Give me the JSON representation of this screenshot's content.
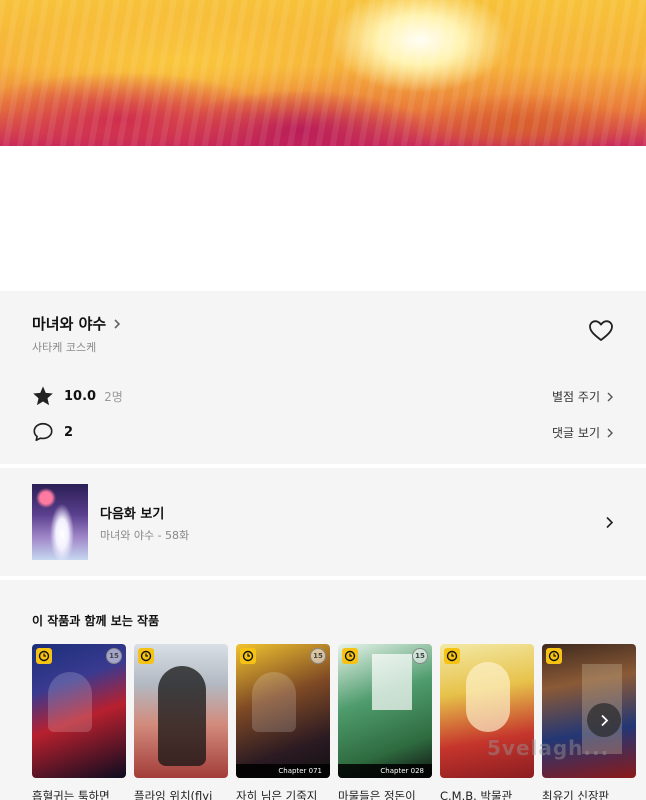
{
  "header": {
    "hero_image": "sunset-clouds-banner"
  },
  "work": {
    "title": "마녀와 야수",
    "author": "사타케 코스케",
    "rating": "10.0",
    "rating_count": "2명",
    "comment_count": "2",
    "rate_link": "별점 주기",
    "comment_link": "댓글 보기"
  },
  "next_episode": {
    "label": "다음화 보기",
    "subtitle": "마녀와 야수 - 58화"
  },
  "recommendations": {
    "heading": "이 작품과 함께 보는 작품",
    "items": [
      {
        "title": "흡혈귀는 툭하면",
        "age": "15",
        "chapter": ""
      },
      {
        "title": "플라잉 위치(flyi",
        "age": "",
        "chapter": ""
      },
      {
        "title": "자히 님은 기죽지",
        "age": "15",
        "chapter": "Chapter 071"
      },
      {
        "title": "마물들은 정돈이",
        "age": "15",
        "chapter": "Chapter 028"
      },
      {
        "title": "C.M.B. 박물관",
        "age": "",
        "chapter": ""
      },
      {
        "title": "최유기 신장판",
        "age": "",
        "chapter": ""
      }
    ]
  },
  "watermark": "5velagh..."
}
